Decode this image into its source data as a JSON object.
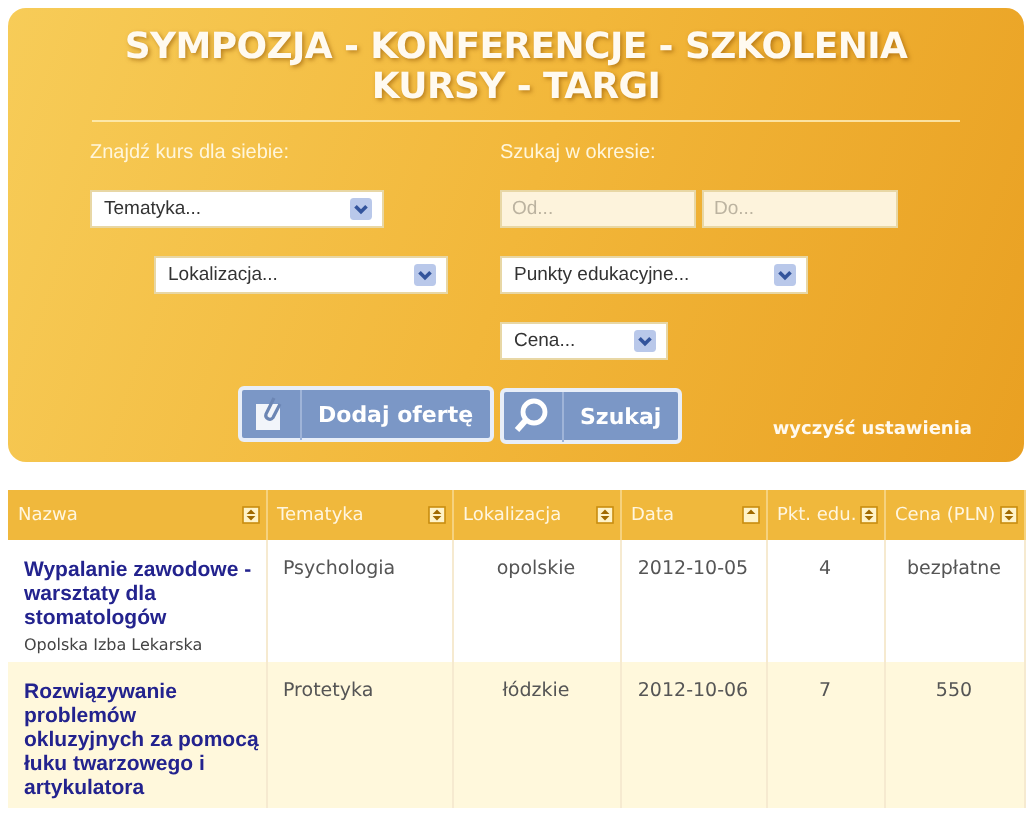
{
  "banner": {
    "title_lines": [
      "SYMPOZJA - KONFERENCJE - SZKOLENIA",
      "KURSY - TARGI"
    ],
    "left_label": "Znajdź kurs dla siebie:",
    "right_label": "Szukaj w okresie:",
    "topic_select": "Tematyka...",
    "location_select": "Lokalizacja...",
    "date_from": {
      "placeholder": "Od..."
    },
    "date_to": {
      "placeholder": "Do..."
    },
    "points_select": "Punkty edukacyjne...",
    "price_select": "Cena...",
    "add_button": "Dodaj ofertę",
    "search_button": "Szukaj",
    "reset_link": "wyczyść ustawienia"
  },
  "table": {
    "columns": [
      {
        "label": "Nazwa",
        "sorted": false
      },
      {
        "label": "Tematyka",
        "sorted": false
      },
      {
        "label": "Lokalizacja",
        "sorted": false
      },
      {
        "label": "Data",
        "sorted": true
      },
      {
        "label": "Pkt. edu.",
        "sorted": false
      },
      {
        "label": "Cena (PLN)",
        "sorted": false
      }
    ],
    "rows": [
      {
        "title": "Wypalanie zawodowe - warsztaty dla stomatologów",
        "organizer": "Opolska Izba Lekarska",
        "topic": "Psychologia",
        "location": "opolskie",
        "date": "2012-10-05",
        "points": "4",
        "price": "bezpłatne"
      },
      {
        "title": "Rozwiązywanie problemów okluzyjnych za pomocą łuku twarzowego i artykulatora",
        "topic": "Protetyka",
        "location": "łódzkie",
        "date": "2012-10-06",
        "points": "7",
        "price": "550"
      }
    ]
  }
}
